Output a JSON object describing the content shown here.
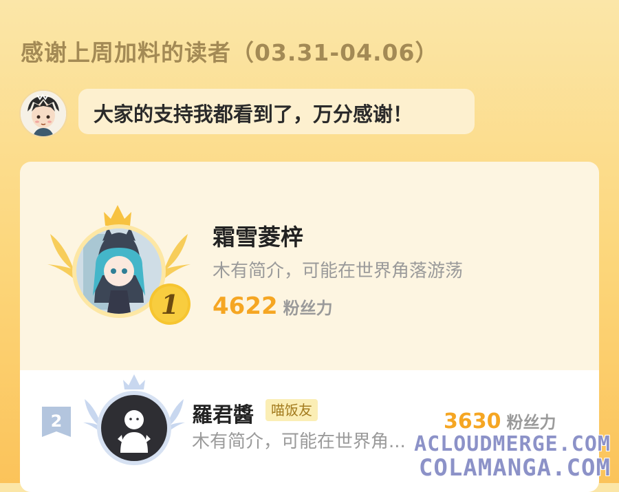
{
  "header": {
    "title": "感谢上周加料的读者（03.31-04.06）"
  },
  "author_message": {
    "text": "大家的支持我都看到了，万分感谢！"
  },
  "ranking": [
    {
      "rank": "1",
      "name": "霜雪菱梓",
      "bio": "木有简介，可能在世界角落游荡",
      "fans_value": "4622",
      "fans_label": "粉丝力"
    },
    {
      "rank": "2",
      "name": "羅君醬",
      "tag": "喵饭友",
      "bio": "木有简介，可能在世界角...",
      "fans_value": "3630",
      "fans_label": "粉丝力"
    }
  ],
  "watermarks": [
    "ACLOUDMERGE.COM",
    "COLAMANGA.COM"
  ],
  "colors": {
    "accent": "#f5a623",
    "title": "#a38a55",
    "card": "#fdf5e1"
  }
}
